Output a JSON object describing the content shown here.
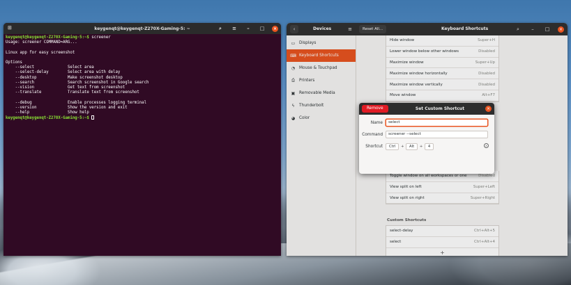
{
  "terminal": {
    "title": "keygenqt@keygenqt-Z270X-Gaming-5: ~",
    "prompt": "keygenqt@keygenqt-Z270X-Gaming-5:~$",
    "command": " screener",
    "output": [
      "Usage: screener COMMAND=ARG...",
      "",
      "Linux app for easy screenshot",
      "",
      "Options",
      "    --select              Select area",
      "    --select-delay        Select area with delay",
      "    --desktop             Make screenshot desktop",
      "    --search              Search screenshot in Google search",
      "    --vision              Get text from screenshot",
      "    --translate           Translate text from screenshot",
      "",
      "    --debug               Enable processes logging terminal",
      "    --version             Show the version and exit",
      "    --help                Show help"
    ],
    "prompt2": "keygenqt@keygenqt-Z270X-Gaming-5:~$"
  },
  "settings": {
    "devices_label": "Devices",
    "reset_label": "Reset All...",
    "title": "Keyboard Shortcuts",
    "sidebar": [
      {
        "label": "Displays",
        "icon": "display-icon"
      },
      {
        "label": "Keyboard Shortcuts",
        "icon": "keyboard-icon"
      },
      {
        "label": "Mouse & Touchpad",
        "icon": "mouse-icon"
      },
      {
        "label": "Printers",
        "icon": "printer-icon"
      },
      {
        "label": "Removable Media",
        "icon": "media-icon"
      },
      {
        "label": "Thunderbolt",
        "icon": "thunderbolt-icon"
      },
      {
        "label": "Color",
        "icon": "color-icon"
      }
    ],
    "shortcuts": [
      {
        "name": "Hide window",
        "accel": "Super+H"
      },
      {
        "name": "Lower window below other windows",
        "accel": "Disabled"
      },
      {
        "name": "Maximize window",
        "accel": "Super+Up"
      },
      {
        "name": "Maximize window horizontally",
        "accel": "Disabled"
      },
      {
        "name": "Maximize window vertically",
        "accel": "Disabled"
      },
      {
        "name": "Move window",
        "accel": "Alt+F7"
      }
    ],
    "shortcuts_lower": [
      {
        "name": "Toggle window on all workspaces or one",
        "accel": "Disabled"
      },
      {
        "name": "View split on left",
        "accel": "Super+Left"
      },
      {
        "name": "View split on right",
        "accel": "Super+Right"
      }
    ],
    "custom_title": "Custom Shortcuts",
    "custom": [
      {
        "name": "select-delay",
        "accel": "Ctrl+Alt+5"
      },
      {
        "name": "select",
        "accel": "Ctrl+Alt+4"
      }
    ],
    "add_label": "+"
  },
  "dialog": {
    "remove_label": "Remove",
    "title": "Set Custom Shortcut",
    "name_label": "Name",
    "name_value": "select",
    "command_label": "Command",
    "command_value": "screener --select",
    "shortcut_label": "Shortcut",
    "keys": [
      "Ctrl",
      "Alt",
      "4"
    ]
  }
}
